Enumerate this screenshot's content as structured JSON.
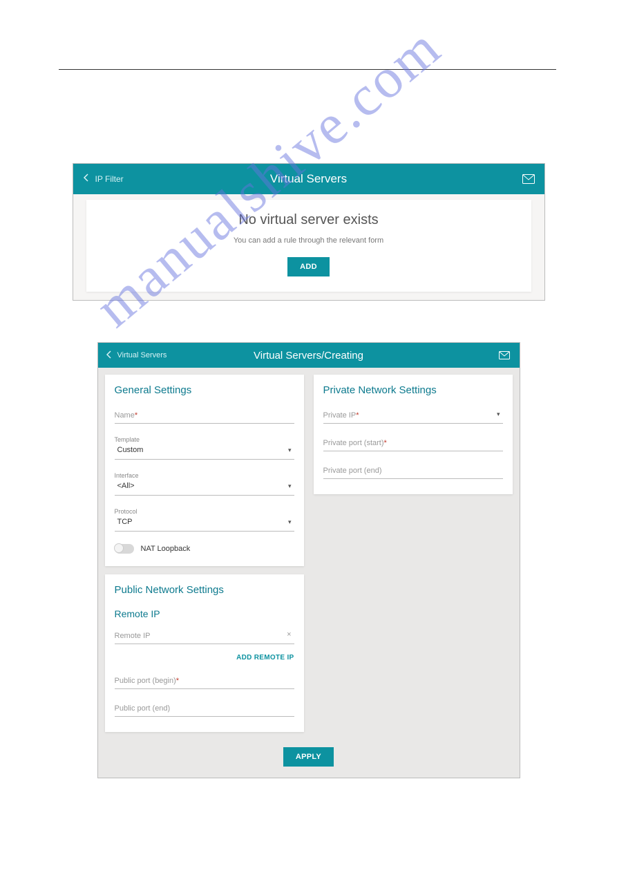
{
  "watermark": "manualshive.com",
  "panel1": {
    "back_label": "IP Filter",
    "title": "Virtual Servers",
    "empty": {
      "heading": "No virtual server exists",
      "subtext": "You can add a rule through the relevant form",
      "add_button": "ADD"
    }
  },
  "panel2": {
    "back_label": "Virtual Servers",
    "title": "Virtual Servers/Creating",
    "general": {
      "section_title": "General Settings",
      "name_label": "Name",
      "template_label": "Template",
      "template_value": "Custom",
      "interface_label": "Interface",
      "interface_value": "<All>",
      "protocol_label": "Protocol",
      "protocol_value": "TCP",
      "nat_loopback_label": "NAT Loopback"
    },
    "private": {
      "section_title": "Private Network Settings",
      "private_ip_label": "Private IP",
      "private_port_start_label": "Private port (start)",
      "private_port_end_label": "Private port (end)"
    },
    "public": {
      "section_title": "Public Network Settings",
      "remote_ip_heading": "Remote IP",
      "remote_ip_label": "Remote IP",
      "add_remote_ip_button": "ADD REMOTE IP",
      "public_port_begin_label": "Public port (begin)",
      "public_port_end_label": "Public port (end)"
    },
    "apply_button": "APPLY"
  }
}
